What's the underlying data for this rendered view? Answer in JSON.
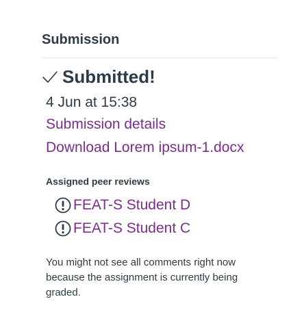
{
  "submission": {
    "section_title": "Submission",
    "status": "Submitted!",
    "status_icon": "check-icon",
    "date": "4 Jun at 15:38",
    "details_link": "Submission details",
    "download_link": "Download Lorem ipsum-1.docx"
  },
  "peer_reviews": {
    "heading": "Assigned peer reviews",
    "items": [
      {
        "icon": "warning-icon",
        "label": "FEAT-S Student D"
      },
      {
        "icon": "warning-icon",
        "label": "FEAT-S Student C"
      }
    ]
  },
  "note": "You might not see all comments right now because the assignment is currently being graded.",
  "colors": {
    "text": "#2d3b45",
    "link": "#7b2d8b",
    "divider": "#e5e7eb"
  }
}
